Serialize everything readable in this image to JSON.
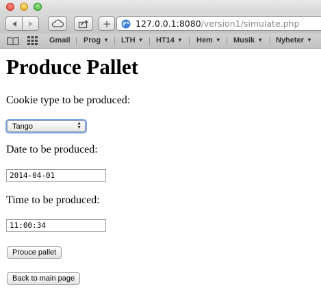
{
  "browser": {
    "url_host": "127.0.0.1:8080",
    "url_path": "/version1/simulate.php",
    "bookmarks": [
      "Gmail",
      "Prog",
      "LTH",
      "HT14",
      "Hem",
      "Musik",
      "Nyheter"
    ],
    "plus_symbol": "+"
  },
  "page": {
    "title": "Produce Pallet",
    "cookie_label": "Cookie type to be produced:",
    "cookie_selected": "Tango",
    "date_label": "Date to be produced:",
    "date_value": "2014-04-01",
    "time_label": "Time to be produced:",
    "time_value": "11:00:34",
    "produce_button": "Prouce pallet",
    "back_button": "Back to main page"
  }
}
